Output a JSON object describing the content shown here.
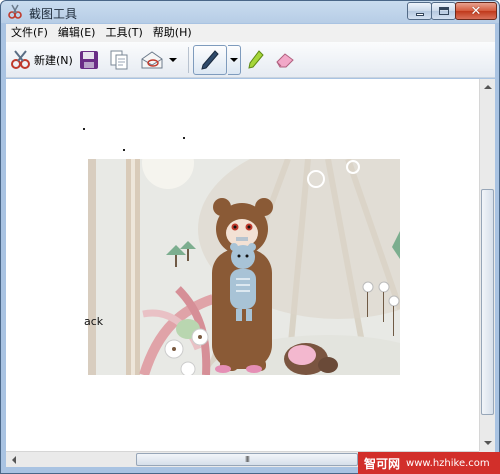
{
  "window": {
    "title": "截图工具",
    "icon": "scissors-icon",
    "controls": {
      "minimize": "minimize-icon",
      "maximize": "maximize-icon",
      "close": "close-icon"
    }
  },
  "menubar": {
    "items": [
      {
        "label": "文件(F)"
      },
      {
        "label": "编辑(E)"
      },
      {
        "label": "工具(T)"
      },
      {
        "label": "帮助(H)"
      }
    ]
  },
  "toolbar": {
    "new_label": "新建(N)",
    "buttons": [
      "new-snip",
      "save",
      "copy",
      "send",
      "pen",
      "highlighter",
      "eraser"
    ]
  },
  "canvas": {
    "snippet_fragment_text": "ack"
  },
  "hscroll": {
    "grip": "III"
  },
  "watermark": {
    "brand": "智可网",
    "url": "www.hzhike.com"
  },
  "colors": {
    "title_bar": "#b7cde6",
    "canvas": "#ffffff",
    "watermark": "#d22f2a"
  }
}
